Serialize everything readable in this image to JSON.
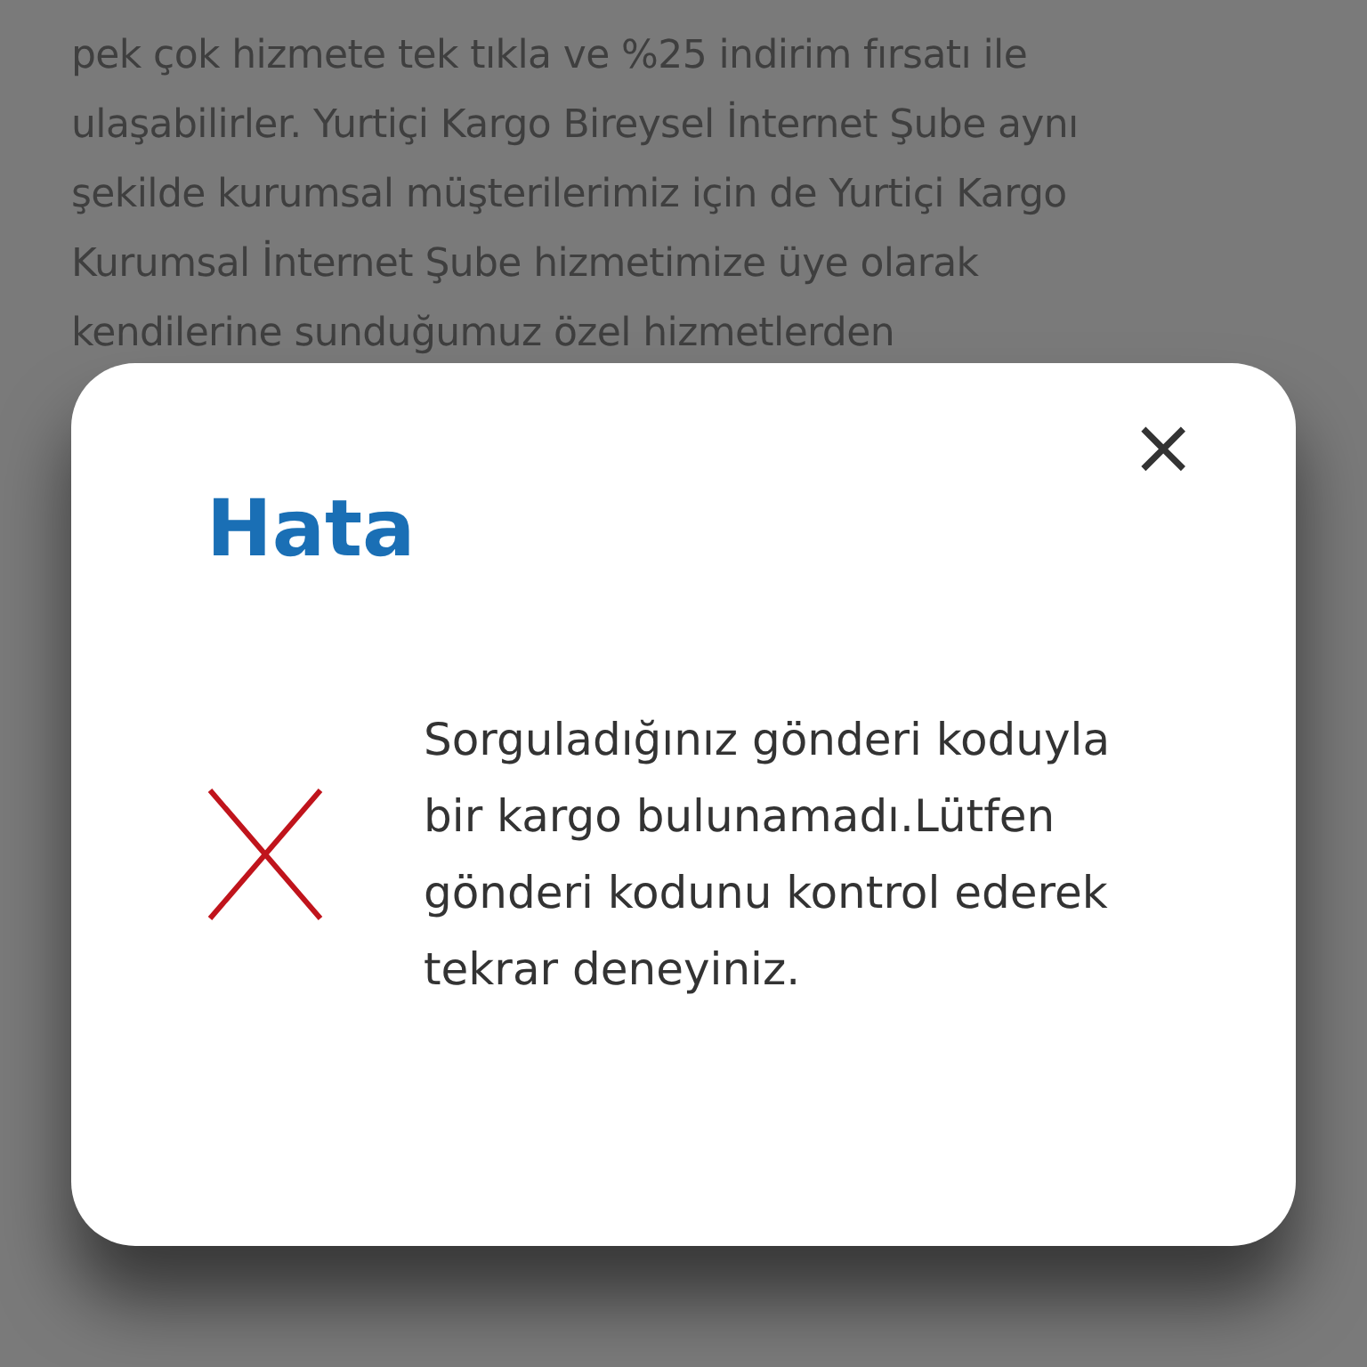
{
  "background_text": {
    "lines": [
      "pek çok hizmete tek tıkla ve %25 indirim fırsatı ile",
      "ulaşabilirler. Yurtiçi Kargo Bireysel İnternet Şube aynı",
      "şekilde kurumsal müşterilerimiz için de Yurtiçi Kargo",
      "Kurumsal İnternet Şube hizmetimize üye olarak",
      "kendilerine sunduğumuz özel hizmetlerden"
    ]
  },
  "dialog": {
    "title": "Hata",
    "close": "×",
    "message": "Sorguladığınız gönderi koduyla bir kargo bulunamadı.Lütfen gönderi kodunu kontrol ederek tekrar deneyiniz."
  }
}
